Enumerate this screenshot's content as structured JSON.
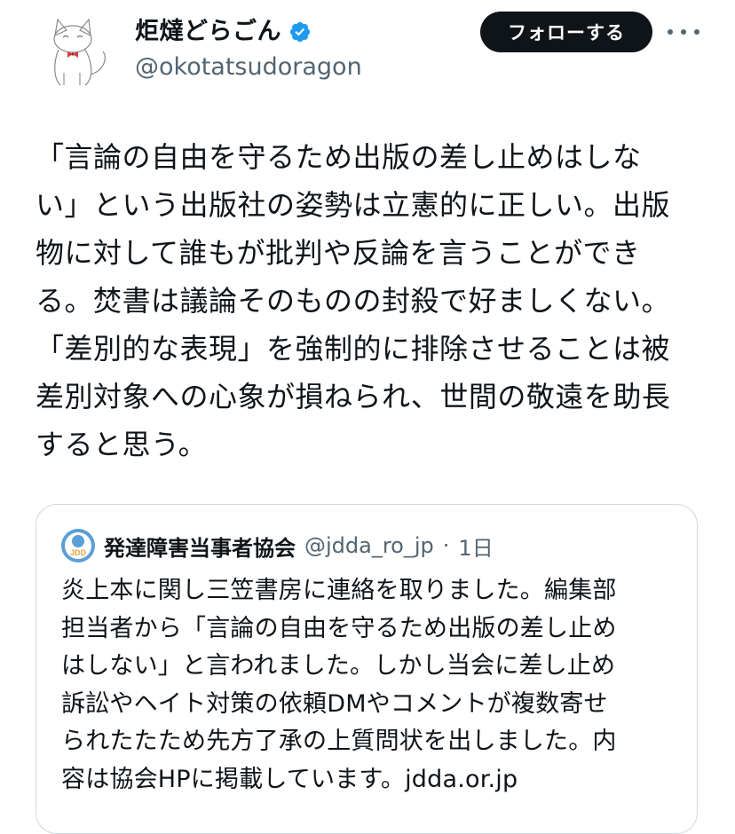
{
  "author": {
    "display_name": "炬燵どらごん",
    "handle": "@okotatsudoragon",
    "avatar_icon": "cat-avatar-icon",
    "verified_icon": "verified-badge-icon",
    "verified_color": "#1d9bf0"
  },
  "actions": {
    "follow_label": "フォローする",
    "more_icon": "more-options-icon"
  },
  "tweet": {
    "text": "「言論の自由を守るため出版の差し止めはしな\nい」という出版社の姿勢は立憲的に正しい。出版\n物に対して誰もが批判や反論を言うことができ\nる。焚書は議論そのものの封殺で好ましくない。\n「差別的な表現」を強制的に排除させることは被\n差別対象への心象が損ねられ、世間の敬遠を助長\nすると思う。"
  },
  "quoted_tweet": {
    "display_name": "発達障害当事者協会",
    "handle": "@jdda_ro_jp",
    "separator": "·",
    "time": "1日",
    "avatar_icon": "jdda-logo-icon",
    "text": "炎上本に関し三笠書房に連絡を取りました。編集部\n担当者から「言論の自由を守るため出版の差し止め\nはしない」と言われました。しかし当会に差し止め\n訴訟やヘイト対策の依頼DMやコメントが複数寄せ\nられたたため先方了承の上質問状を出しました。内\n容は協会HPに掲載しています。jdda.or.jp"
  },
  "colors": {
    "text_primary": "#0f1419",
    "text_secondary": "#536471",
    "follow_bg": "#0f1419",
    "border": "#cfd9de"
  }
}
